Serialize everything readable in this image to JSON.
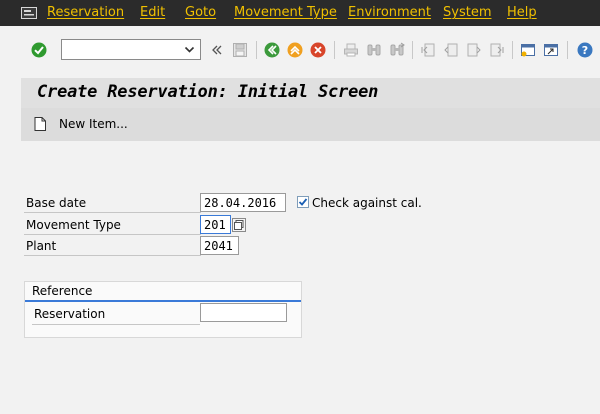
{
  "menu": {
    "items": [
      "Reservation",
      "Edit",
      "Goto",
      "Movement Type",
      "Environment",
      "System",
      "Help"
    ]
  },
  "toolbar": {
    "command_value": "",
    "icons": [
      "enter-icon",
      "command-dropdown-icon",
      "collapse-icon",
      "save-icon",
      "back-icon",
      "exit-icon",
      "cancel-icon",
      "print-icon",
      "find-icon",
      "find-next-icon",
      "first-page-icon",
      "previous-page-icon",
      "next-page-icon",
      "last-page-icon",
      "create-session-icon",
      "shortcut-icon",
      "help-icon"
    ]
  },
  "title": "Create Reservation: Initial Screen",
  "app_toolbar": {
    "new_item_label": "New Item..."
  },
  "form": {
    "base_date": {
      "label": "Base date",
      "value": "28.04.2016"
    },
    "check_calendar": {
      "label": "Check against cal.",
      "checked": true
    },
    "movement_type": {
      "label": "Movement Type",
      "value": "201"
    },
    "plant": {
      "label": "Plant",
      "value": "2041"
    }
  },
  "reference": {
    "title": "Reference",
    "reservation": {
      "label": "Reservation",
      "value": ""
    }
  },
  "colors": {
    "menubar_bg": "#2b2b2b",
    "menu_text": "#f0c000",
    "focus": "#3a7ad8"
  }
}
